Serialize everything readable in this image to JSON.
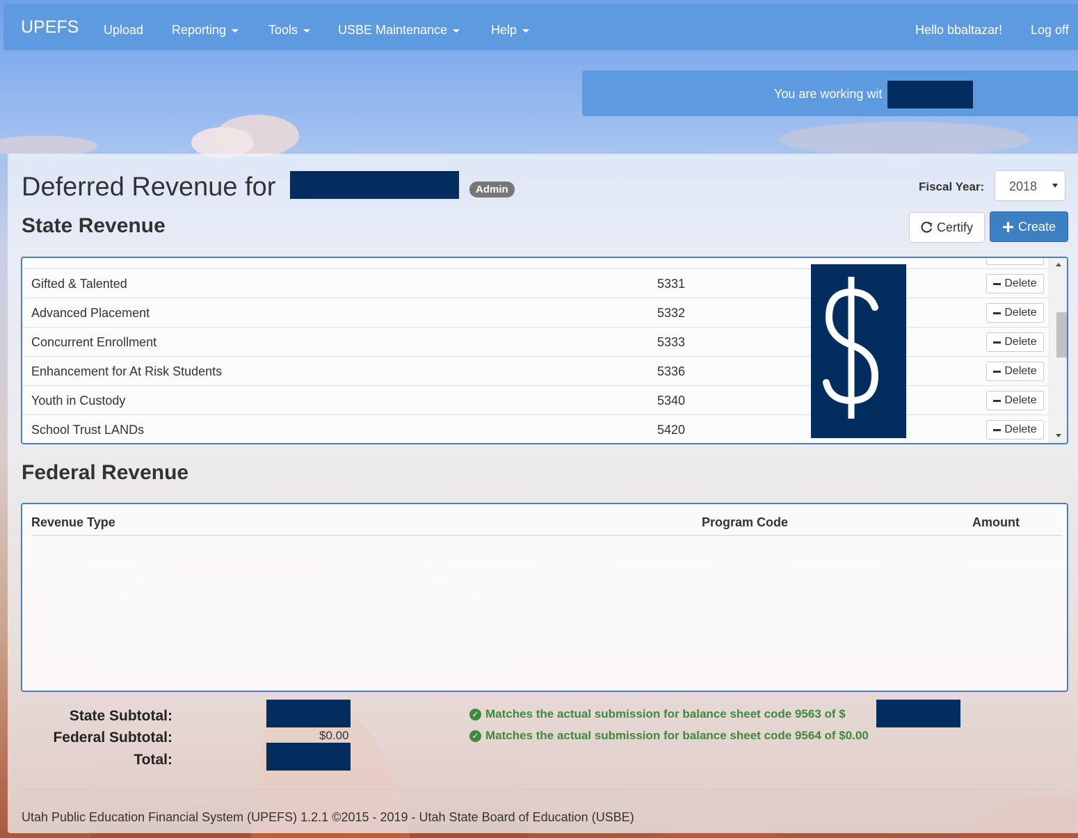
{
  "navbar": {
    "brand": "UPEFS",
    "items": [
      {
        "label": "Upload",
        "dropdown": false
      },
      {
        "label": "Reporting",
        "dropdown": true
      },
      {
        "label": "Tools",
        "dropdown": true
      },
      {
        "label": "USBE Maintenance",
        "dropdown": true
      },
      {
        "label": "Help",
        "dropdown": true
      }
    ],
    "greeting": "Hello bbaltazar!",
    "logoff": "Log off"
  },
  "banner": {
    "text": "You are working wit"
  },
  "page": {
    "title": "Deferred Revenue for",
    "badge": "Admin",
    "fiscal_year_label": "Fiscal Year:",
    "fiscal_year_value": "2018",
    "certify_label": "Certify",
    "create_label": "Create"
  },
  "state": {
    "heading": "State Revenue",
    "rows": [
      {
        "type": "Gifted & Talented",
        "code": "5331",
        "action": "Delete"
      },
      {
        "type": "Advanced Placement",
        "code": "5332",
        "action": "Delete"
      },
      {
        "type": "Concurrent Enrollment",
        "code": "5333",
        "action": "Delete"
      },
      {
        "type": "Enhancement for At Risk Students",
        "code": "5336",
        "action": "Delete"
      },
      {
        "type": "Youth in Custody",
        "code": "5340",
        "action": "Delete"
      },
      {
        "type": "School Trust LANDs",
        "code": "5420",
        "action": "Delete"
      }
    ],
    "redaction_symbol": "$"
  },
  "federal": {
    "heading": "Federal Revenue",
    "columns": {
      "type": "Revenue Type",
      "code": "Program Code",
      "amount": "Amount"
    }
  },
  "summary": {
    "state_label": "State Subtotal:",
    "federal_label": "Federal Subtotal:",
    "total_label": "Total:",
    "federal_value": "$0.00",
    "state_match": "Matches the actual submission for balance sheet code 9563 of $",
    "federal_match": "Matches the actual submission for balance sheet code 9564 of $0.00"
  },
  "footer": {
    "text": "Utah Public Education Financial System (UPEFS) 1.2.1 ©2015 - 2019 - Utah State Board of Education (USBE)"
  },
  "colors": {
    "navbar": "#5d9ae0",
    "primary": "#3c7fc3",
    "success": "#3c8a3c",
    "redaction": "#032d5e"
  }
}
